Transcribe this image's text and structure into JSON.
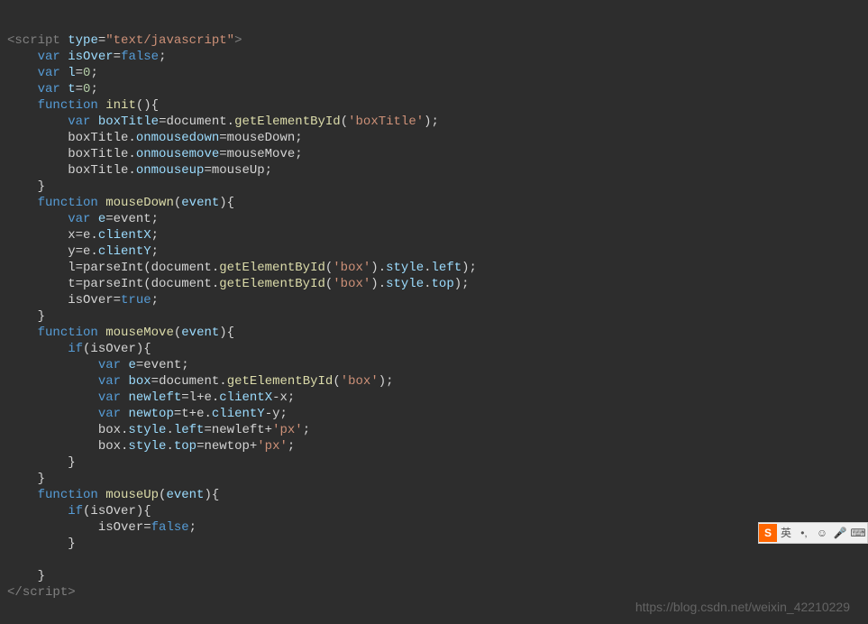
{
  "watermark": "https://blog.csdn.net/weixin_42210229",
  "ime": {
    "logo": "S",
    "items": [
      "英",
      "•,",
      "☺",
      "🎤",
      "⌨"
    ]
  },
  "code": {
    "lines": [
      [
        {
          "c": "tok-tag",
          "t": "<"
        },
        {
          "c": "tok-tag",
          "t": "script"
        },
        {
          "c": "tok-plain",
          "t": " "
        },
        {
          "c": "tok-attr",
          "t": "type"
        },
        {
          "c": "tok-plain",
          "t": "="
        },
        {
          "c": "tok-str",
          "t": "\"text/javascript\""
        },
        {
          "c": "tok-tag",
          "t": ">"
        }
      ],
      [
        {
          "c": "tok-plain",
          "t": "    "
        },
        {
          "c": "tok-kw",
          "t": "var"
        },
        {
          "c": "tok-plain",
          "t": " "
        },
        {
          "c": "tok-var",
          "t": "isOver"
        },
        {
          "c": "tok-plain",
          "t": "="
        },
        {
          "c": "tok-const",
          "t": "false"
        },
        {
          "c": "tok-plain",
          "t": ";"
        }
      ],
      [
        {
          "c": "tok-plain",
          "t": "    "
        },
        {
          "c": "tok-kw",
          "t": "var"
        },
        {
          "c": "tok-plain",
          "t": " "
        },
        {
          "c": "tok-var",
          "t": "l"
        },
        {
          "c": "tok-plain",
          "t": "="
        },
        {
          "c": "tok-num",
          "t": "0"
        },
        {
          "c": "tok-plain",
          "t": ";"
        }
      ],
      [
        {
          "c": "tok-plain",
          "t": "    "
        },
        {
          "c": "tok-kw",
          "t": "var"
        },
        {
          "c": "tok-plain",
          "t": " "
        },
        {
          "c": "tok-var",
          "t": "t"
        },
        {
          "c": "tok-plain",
          "t": "="
        },
        {
          "c": "tok-num",
          "t": "0"
        },
        {
          "c": "tok-plain",
          "t": ";"
        }
      ],
      [
        {
          "c": "tok-plain",
          "t": "    "
        },
        {
          "c": "tok-kw",
          "t": "function"
        },
        {
          "c": "tok-plain",
          "t": " "
        },
        {
          "c": "tok-func",
          "t": "init"
        },
        {
          "c": "tok-plain",
          "t": "(){"
        }
      ],
      [
        {
          "c": "tok-plain",
          "t": "        "
        },
        {
          "c": "tok-kw",
          "t": "var"
        },
        {
          "c": "tok-plain",
          "t": " "
        },
        {
          "c": "tok-var",
          "t": "boxTitle"
        },
        {
          "c": "tok-plain",
          "t": "=document."
        },
        {
          "c": "tok-func",
          "t": "getElementById"
        },
        {
          "c": "tok-plain",
          "t": "("
        },
        {
          "c": "tok-str",
          "t": "'boxTitle'"
        },
        {
          "c": "tok-plain",
          "t": ");"
        }
      ],
      [
        {
          "c": "tok-plain",
          "t": "        boxTitle."
        },
        {
          "c": "tok-prop",
          "t": "onmousedown"
        },
        {
          "c": "tok-plain",
          "t": "=mouseDown;"
        }
      ],
      [
        {
          "c": "tok-plain",
          "t": "        boxTitle."
        },
        {
          "c": "tok-prop",
          "t": "onmousemove"
        },
        {
          "c": "tok-plain",
          "t": "=mouseMove;"
        }
      ],
      [
        {
          "c": "tok-plain",
          "t": "        boxTitle."
        },
        {
          "c": "tok-prop",
          "t": "onmouseup"
        },
        {
          "c": "tok-plain",
          "t": "=mouseUp;"
        }
      ],
      [
        {
          "c": "tok-plain",
          "t": "    }"
        }
      ],
      [
        {
          "c": "tok-plain",
          "t": "    "
        },
        {
          "c": "tok-kw",
          "t": "function"
        },
        {
          "c": "tok-plain",
          "t": " "
        },
        {
          "c": "tok-func",
          "t": "mouseDown"
        },
        {
          "c": "tok-plain",
          "t": "("
        },
        {
          "c": "tok-param",
          "t": "event"
        },
        {
          "c": "tok-plain",
          "t": "){"
        }
      ],
      [
        {
          "c": "tok-plain",
          "t": "        "
        },
        {
          "c": "tok-kw",
          "t": "var"
        },
        {
          "c": "tok-plain",
          "t": " "
        },
        {
          "c": "tok-var",
          "t": "e"
        },
        {
          "c": "tok-plain",
          "t": "=event;"
        }
      ],
      [
        {
          "c": "tok-plain",
          "t": "        x=e."
        },
        {
          "c": "tok-prop",
          "t": "clientX"
        },
        {
          "c": "tok-plain",
          "t": ";"
        }
      ],
      [
        {
          "c": "tok-plain",
          "t": "        y=e."
        },
        {
          "c": "tok-prop",
          "t": "clientY"
        },
        {
          "c": "tok-plain",
          "t": ";"
        }
      ],
      [
        {
          "c": "tok-plain",
          "t": "        l=parseInt(document."
        },
        {
          "c": "tok-func",
          "t": "getElementById"
        },
        {
          "c": "tok-plain",
          "t": "("
        },
        {
          "c": "tok-str",
          "t": "'box'"
        },
        {
          "c": "tok-plain",
          "t": ")."
        },
        {
          "c": "tok-prop",
          "t": "style"
        },
        {
          "c": "tok-plain",
          "t": "."
        },
        {
          "c": "tok-prop",
          "t": "left"
        },
        {
          "c": "tok-plain",
          "t": ");"
        }
      ],
      [
        {
          "c": "tok-plain",
          "t": "        t=parseInt(document."
        },
        {
          "c": "tok-func",
          "t": "getElementById"
        },
        {
          "c": "tok-plain",
          "t": "("
        },
        {
          "c": "tok-str",
          "t": "'box'"
        },
        {
          "c": "tok-plain",
          "t": ")."
        },
        {
          "c": "tok-prop",
          "t": "style"
        },
        {
          "c": "tok-plain",
          "t": "."
        },
        {
          "c": "tok-prop",
          "t": "top"
        },
        {
          "c": "tok-plain",
          "t": ");"
        }
      ],
      [
        {
          "c": "tok-plain",
          "t": "        isOver="
        },
        {
          "c": "tok-const",
          "t": "true"
        },
        {
          "c": "tok-plain",
          "t": ";"
        }
      ],
      [
        {
          "c": "tok-plain",
          "t": "    }"
        }
      ],
      [
        {
          "c": "tok-plain",
          "t": "    "
        },
        {
          "c": "tok-kw",
          "t": "function"
        },
        {
          "c": "tok-plain",
          "t": " "
        },
        {
          "c": "tok-func",
          "t": "mouseMove"
        },
        {
          "c": "tok-plain",
          "t": "("
        },
        {
          "c": "tok-param",
          "t": "event"
        },
        {
          "c": "tok-plain",
          "t": "){"
        }
      ],
      [
        {
          "c": "tok-plain",
          "t": "        "
        },
        {
          "c": "tok-kw",
          "t": "if"
        },
        {
          "c": "tok-plain",
          "t": "(isOver){"
        }
      ],
      [
        {
          "c": "tok-plain",
          "t": "            "
        },
        {
          "c": "tok-kw",
          "t": "var"
        },
        {
          "c": "tok-plain",
          "t": " "
        },
        {
          "c": "tok-var",
          "t": "e"
        },
        {
          "c": "tok-plain",
          "t": "=event;"
        }
      ],
      [
        {
          "c": "tok-plain",
          "t": "            "
        },
        {
          "c": "tok-kw",
          "t": "var"
        },
        {
          "c": "tok-plain",
          "t": " "
        },
        {
          "c": "tok-var",
          "t": "box"
        },
        {
          "c": "tok-plain",
          "t": "=document."
        },
        {
          "c": "tok-func",
          "t": "getElementById"
        },
        {
          "c": "tok-plain",
          "t": "("
        },
        {
          "c": "tok-str",
          "t": "'box'"
        },
        {
          "c": "tok-plain",
          "t": ");"
        }
      ],
      [
        {
          "c": "tok-plain",
          "t": "            "
        },
        {
          "c": "tok-kw",
          "t": "var"
        },
        {
          "c": "tok-plain",
          "t": " "
        },
        {
          "c": "tok-var",
          "t": "newleft"
        },
        {
          "c": "tok-plain",
          "t": "=l+e."
        },
        {
          "c": "tok-prop",
          "t": "clientX"
        },
        {
          "c": "tok-plain",
          "t": "-x;"
        }
      ],
      [
        {
          "c": "tok-plain",
          "t": "            "
        },
        {
          "c": "tok-kw",
          "t": "var"
        },
        {
          "c": "tok-plain",
          "t": " "
        },
        {
          "c": "tok-var",
          "t": "newtop"
        },
        {
          "c": "tok-plain",
          "t": "=t+e."
        },
        {
          "c": "tok-prop",
          "t": "clientY"
        },
        {
          "c": "tok-plain",
          "t": "-y;"
        }
      ],
      [
        {
          "c": "tok-plain",
          "t": "            box."
        },
        {
          "c": "tok-prop",
          "t": "style"
        },
        {
          "c": "tok-plain",
          "t": "."
        },
        {
          "c": "tok-prop",
          "t": "left"
        },
        {
          "c": "tok-plain",
          "t": "=newleft+"
        },
        {
          "c": "tok-str",
          "t": "'px'"
        },
        {
          "c": "tok-plain",
          "t": ";"
        }
      ],
      [
        {
          "c": "tok-plain",
          "t": "            box."
        },
        {
          "c": "tok-prop",
          "t": "style"
        },
        {
          "c": "tok-plain",
          "t": "."
        },
        {
          "c": "tok-prop",
          "t": "top"
        },
        {
          "c": "tok-plain",
          "t": "=newtop+"
        },
        {
          "c": "tok-str",
          "t": "'px'"
        },
        {
          "c": "tok-plain",
          "t": ";"
        }
      ],
      [
        {
          "c": "tok-plain",
          "t": "        }"
        }
      ],
      [
        {
          "c": "tok-plain",
          "t": "    }"
        }
      ],
      [
        {
          "c": "tok-plain",
          "t": "    "
        },
        {
          "c": "tok-kw",
          "t": "function"
        },
        {
          "c": "tok-plain",
          "t": " "
        },
        {
          "c": "tok-func",
          "t": "mouseUp"
        },
        {
          "c": "tok-plain",
          "t": "("
        },
        {
          "c": "tok-param",
          "t": "event"
        },
        {
          "c": "tok-plain",
          "t": "){"
        }
      ],
      [
        {
          "c": "tok-plain",
          "t": "        "
        },
        {
          "c": "tok-kw",
          "t": "if"
        },
        {
          "c": "tok-plain",
          "t": "(isOver){"
        }
      ],
      [
        {
          "c": "tok-plain",
          "t": "            isOver="
        },
        {
          "c": "tok-const",
          "t": "false"
        },
        {
          "c": "tok-plain",
          "t": ";"
        }
      ],
      [
        {
          "c": "tok-plain",
          "t": "        }"
        }
      ],
      [
        {
          "c": "tok-plain",
          "t": ""
        }
      ],
      [
        {
          "c": "tok-plain",
          "t": "    }"
        }
      ],
      [
        {
          "c": "tok-tag",
          "t": "</"
        },
        {
          "c": "tok-tag",
          "t": "script"
        },
        {
          "c": "tok-tag",
          "t": ">"
        }
      ]
    ]
  }
}
